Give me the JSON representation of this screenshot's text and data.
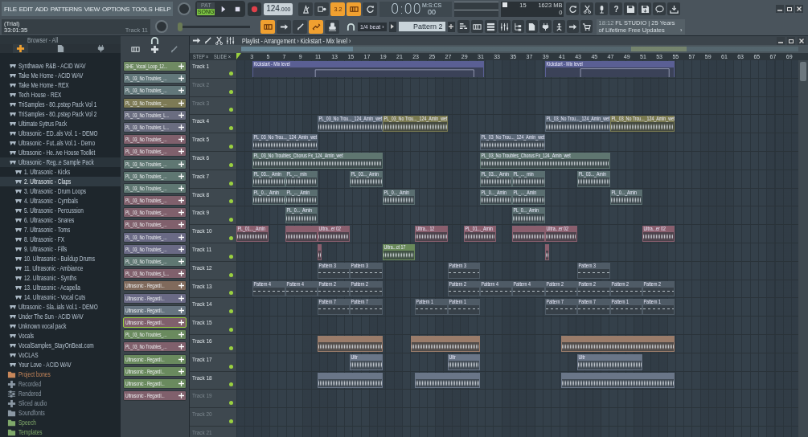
{
  "menu": [
    "FILE",
    "EDIT",
    "ADD",
    "PATTERNS",
    "VIEW",
    "OPTIONS",
    "TOOLS",
    "HELP"
  ],
  "hint": {
    "line_1": "(Trial)",
    "line_2": "33:01:35",
    "target": "Track 11"
  },
  "transport": {
    "modes": [
      {
        "label": "PAT",
        "selected": false
      },
      {
        "label": "SONG",
        "selected": true
      }
    ],
    "tempo": "124",
    "tempo_fraction": ".000"
  },
  "record_toggles": [
    {
      "kind": "metronome",
      "on": false
    },
    {
      "kind": "wait",
      "on": false
    },
    {
      "kind": "countdown",
      "label": "3.2",
      "on": true
    },
    {
      "kind": "keyboard",
      "on": true
    },
    {
      "kind": "loop",
      "on": false
    }
  ],
  "time": {
    "value": "0:00",
    "centis": "00",
    "units": "M:S:CS"
  },
  "cpu": {
    "cpu": "15",
    "memory": "1623 MB",
    "polyphony": "0"
  },
  "top_icons": [
    {
      "kind": "refresh"
    },
    {
      "kind": "cut"
    },
    {
      "kind": "mic"
    },
    {
      "kind": "help",
      "label": "?"
    },
    {
      "kind": "save"
    },
    {
      "kind": "export"
    },
    {
      "kind": "chat"
    },
    {
      "kind": "download"
    }
  ],
  "pitch": {
    "level": 0.0
  },
  "edit_toggles": [
    {
      "kind": "piano",
      "on": true
    },
    {
      "kind": "arrow",
      "on": false
    },
    {
      "kind": "brush",
      "on": false
    },
    {
      "kind": "link",
      "on": true
    },
    {
      "kind": "stamp",
      "on": false
    }
  ],
  "snap": "1/4 beat ›",
  "pattern": "Pattern 2",
  "view_icons": [
    {
      "kind": "playlist"
    },
    {
      "kind": "piano"
    },
    {
      "kind": "rack"
    },
    {
      "kind": "mixer"
    },
    {
      "kind": "tree"
    },
    {
      "kind": "page"
    },
    {
      "kind": "plug"
    },
    {
      "kind": "figure"
    },
    {
      "kind": "pointer"
    },
    {
      "kind": "cart"
    }
  ],
  "news": {
    "time": "18:12",
    "line_1": "FL STUDIO | 25 Years",
    "line_2": "of Lifetime Free Updates",
    "arrow": "›"
  },
  "browser": {
    "title": "Browser - All",
    "tabs": [
      {
        "kind": "all",
        "selected": true
      },
      {
        "kind": "page",
        "selected": false
      },
      {
        "kind": "plug",
        "selected": false
      }
    ],
    "packs": [
      {
        "label": "Synthwave R&B - ACID WAV",
        "selected": false,
        "expanded": false
      },
      {
        "label": "Take Me Home - ACID WAV",
        "selected": false,
        "expanded": false
      },
      {
        "label": "Take Me Home - REX",
        "selected": false,
        "expanded": false
      },
      {
        "label": "Tech House - REX",
        "selected": false,
        "expanded": false
      },
      {
        "label": "TriSamples - 80..pstep Pack Vol 1",
        "selected": false,
        "expanded": false
      },
      {
        "label": "TriSamples - 80..pstep Pack Vol 2",
        "selected": false,
        "expanded": false
      },
      {
        "label": "Ultimate Sytrus Pack",
        "selected": false,
        "expanded": false
      },
      {
        "label": "Ultrasonic - ED..als Vol. 1 - DEMO",
        "selected": false,
        "expanded": false
      },
      {
        "label": "Ultrasonic - Fut..als Vol.1 - Demo",
        "selected": false,
        "expanded": false
      },
      {
        "label": "Ultrasonic - He..ive House Toolkit",
        "selected": false,
        "expanded": false
      },
      {
        "label": "Ultrasonic - Reg..e Sample Pack",
        "selected": false,
        "expanded": true,
        "children": [
          {
            "label": "1. Ultrasonic - Kicks",
            "selected": false
          },
          {
            "label": "2. Ultrasonic - Claps",
            "selected": true
          },
          {
            "label": "3. Ultrasonic - Drum Loops",
            "selected": false
          },
          {
            "label": "4. Ultrasonic - Cymbals",
            "selected": false
          },
          {
            "label": "5. Ultrasonic - Percussion",
            "selected": false
          },
          {
            "label": "6. Ultrasonic - Snares",
            "selected": false
          },
          {
            "label": "7. Ultrasonic - Toms",
            "selected": false
          },
          {
            "label": "8. Ultrasonic - FX",
            "selected": false
          },
          {
            "label": "9. Ultrasonic - Fills",
            "selected": false
          },
          {
            "label": "10. Ultrasonic - Buildup Drums",
            "selected": false
          },
          {
            "label": "11. Ultrasonic - Ambiance",
            "selected": false
          },
          {
            "label": "12. Ultrasonic - Synths",
            "selected": false
          },
          {
            "label": "13. Ultrasonic - Acapella",
            "selected": false
          },
          {
            "label": "14. Ultrasonic - Vocal Cuts",
            "selected": false
          }
        ]
      },
      {
        "label": "Ultrasonic - Sla..ials Vol.1 - DEMO",
        "selected": false,
        "expanded": false
      },
      {
        "label": "Under The Sun - ACID WAV",
        "selected": false,
        "expanded": false
      },
      {
        "label": "Unknown vocal pack",
        "selected": false,
        "expanded": false
      },
      {
        "label": "Vocals",
        "selected": false,
        "expanded": false
      },
      {
        "label": "VocalSamples_StayOnBeat.com",
        "selected": false,
        "expanded": false
      },
      {
        "label": "VoCLAS",
        "selected": false,
        "expanded": false
      },
      {
        "label": "Your Love - ACID WAV",
        "selected": false,
        "expanded": false
      }
    ],
    "folders": [
      {
        "label": "Project bones",
        "kind": "folder",
        "color": "#c8875a"
      },
      {
        "label": "Recorded",
        "kind": "plus",
        "color": "#8a97a3"
      },
      {
        "label": "Rendered",
        "kind": "rendered",
        "color": "#8a97a3"
      },
      {
        "label": "Sliced audio",
        "kind": "plus",
        "color": "#8a97a3"
      },
      {
        "label": "Soundfonts",
        "kind": "folder",
        "color": "#8a97a3"
      },
      {
        "label": "Speech",
        "kind": "folder",
        "color": "#7fa86a"
      },
      {
        "label": "Templates",
        "kind": "folder",
        "color": "#7fa86a"
      }
    ]
  },
  "channels": [
    {
      "name": "SHE_Vocal_Loop_12...",
      "color": "#6f8a62",
      "selected": false
    },
    {
      "name": "PL_03_No Troubles_...",
      "color": "#62777a",
      "selected": false
    },
    {
      "name": "PL_03_No Troubles_...",
      "color": "#62777a",
      "selected": false
    },
    {
      "name": "PL_03_No Troubles_...",
      "color": "#7d7a55",
      "selected": false
    },
    {
      "name": "PL_03_No Troubles_L...",
      "color": "#6a6d80",
      "selected": false
    },
    {
      "name": "PL_03_No Troubles_L...",
      "color": "#6a6d80",
      "selected": false
    },
    {
      "name": "PL_03_No Troubles_...",
      "color": "#80606c",
      "selected": false
    },
    {
      "name": "PL_03_No Troubles_...",
      "color": "#80606c",
      "selected": false
    },
    {
      "name": "PL_03_No Troubles_...",
      "color": "#5f7772",
      "selected": false
    },
    {
      "name": "PL_03_No Troubles_...",
      "color": "#5f7772",
      "selected": false
    },
    {
      "name": "PL_03_No Troubles_...",
      "color": "#5f7772",
      "selected": false
    },
    {
      "name": "PL_03_No Troubles_...",
      "color": "#80606c",
      "selected": false
    },
    {
      "name": "PL_03_No Troubles_...",
      "color": "#80606c",
      "selected": false
    },
    {
      "name": "PL_03_No Troubles_...",
      "color": "#80606c",
      "selected": false
    },
    {
      "name": "PL_03_No Troubles_...",
      "color": "#6a6a85",
      "selected": false
    },
    {
      "name": "PL_03_No Troubles_...",
      "color": "#6a6a85",
      "selected": false
    },
    {
      "name": "PL_03_No Troubles_...",
      "color": "#5f7772",
      "selected": false
    },
    {
      "name": "PL_03_No Troubles_L...",
      "color": "#80606c",
      "selected": false
    },
    {
      "name": "Ultrasonic - Regardl...",
      "color": "#806a5c",
      "selected": false
    },
    {
      "name": "Ultrasonic - Regardl...",
      "color": "#6a6a85",
      "selected": false
    },
    {
      "name": "Ultrasonic - Regardl...",
      "color": "#667480",
      "selected": false
    },
    {
      "name": "Ultrasonic - Regardl...",
      "color": "#80606c",
      "selected": true
    },
    {
      "name": "PL_03_No Troubles_...",
      "color": "#6a8a5e",
      "selected": false
    },
    {
      "name": "PL_03_No Troubles_...",
      "color": "#80606c",
      "selected": false
    },
    {
      "name": "Ultrasonic - Regardl...",
      "color": "#6a8a5e",
      "selected": false
    },
    {
      "name": "Ultrasonic - Regardl...",
      "color": "#6a8a5e",
      "selected": false
    },
    {
      "name": "Ultrasonic - Regardl...",
      "color": "#6a8a5e",
      "selected": false
    },
    {
      "name": "Ultrasonic - Regardl...",
      "color": "#80606c",
      "selected": false
    }
  ],
  "playlist": {
    "title": "Playlist - Arrangement › Kickstart - Mix level ›",
    "header_labels": [
      "STEP ×",
      "SLIDE ×"
    ],
    "ruler": [
      "3",
      "5",
      "7",
      "9",
      "11",
      "13",
      "15",
      "17",
      "19",
      "21",
      "23",
      "25",
      "27",
      "29",
      "31",
      "33",
      "35",
      "37",
      "39",
      "41",
      "43",
      "45",
      "47",
      "49",
      "51",
      "53",
      "55",
      "57",
      "59",
      "61",
      "63",
      "65",
      "67",
      "69"
    ],
    "tracks": [
      {
        "label": "Track 1",
        "empty": false,
        "clips": [
          {
            "kind": "automation",
            "label": "Kickstart - Mix level",
            "color": "#5a5f94"
          },
          {
            "kind": "automation",
            "label": "Kickstart - Mix level",
            "color": "#5a5f94"
          }
        ]
      },
      {
        "label": "Track 2",
        "empty": true
      },
      {
        "label": "Track 3",
        "empty": true
      },
      {
        "label": "Track 4",
        "empty": false,
        "clips": [
          {
            "kind": "audio",
            "label": "PL_03_No Trou..._124_Amin_wet",
            "color": "#5b6877"
          },
          {
            "kind": "audio",
            "label": "PL_03_No Trou..._124_Amin_wet",
            "color": "#7a7a50"
          },
          {
            "kind": "audio",
            "label": "PL_03_No Trou..._124_Amin_wet",
            "color": "#5b6877"
          },
          {
            "kind": "audio",
            "label": "PL_03_No Trou..._124_Amin_wet",
            "color": "#7a7a50"
          }
        ]
      },
      {
        "label": "Track 5",
        "empty": false,
        "clips": [
          {
            "kind": "audio",
            "label": "PL_03_No Trou..._124_Amin_wet",
            "color": "#5b6877"
          },
          {
            "kind": "audio",
            "label": "PL_03_No Trou..._124_Amin_wet",
            "color": "#5b6877"
          }
        ]
      },
      {
        "label": "Track 6",
        "empty": false,
        "clips": [
          {
            "kind": "audio",
            "label": "PL_03_No Troubles_Chorus Fx_124_Amin_wet",
            "color": "#5f7670"
          },
          {
            "kind": "audio",
            "label": "PL_03_No Troubles_Chorus Fx_124_Amin_wet",
            "color": "#5f7670"
          }
        ]
      },
      {
        "label": "Track 7",
        "empty": false,
        "clips": [
          {
            "kind": "audio",
            "label": "PL_03..._Amin",
            "color": "#5a6e70"
          },
          {
            "kind": "audio",
            "label": "PL_..._min",
            "color": "#5a6e70"
          },
          {
            "kind": "audio",
            "label": "PL_03..._Amin",
            "color": "#5a6e70"
          },
          {
            "kind": "audio",
            "label": "PL_03..._Amin",
            "color": "#5a6e70"
          },
          {
            "kind": "audio",
            "label": "PL_..._min",
            "color": "#5a6e70"
          },
          {
            "kind": "audio",
            "label": "PL_03..._Amin",
            "color": "#5a6e70"
          }
        ]
      },
      {
        "label": "Track 8",
        "empty": false,
        "clips": [
          {
            "kind": "audio",
            "label": "PL_0..._Amin",
            "color": "#5a6e70"
          },
          {
            "kind": "audio",
            "label": "PL_..._Amin",
            "color": "#5a6e70"
          },
          {
            "kind": "audio",
            "label": "PL_0..._Amin",
            "color": "#5a6e70"
          },
          {
            "kind": "audio",
            "label": "PL_0..._Amin",
            "color": "#5a6e70"
          },
          {
            "kind": "audio",
            "label": "PL_..._Amin",
            "color": "#5a6e70"
          },
          {
            "kind": "audio",
            "label": "PL_0..._Amin",
            "color": "#5a6e70"
          }
        ]
      },
      {
        "label": "Track 9",
        "empty": false,
        "clips": [
          {
            "kind": "audio",
            "label": "PL_0..._Amin",
            "color": "#5a6e70"
          },
          {
            "kind": "audio",
            "label": "PL_0..._Amin",
            "color": "#5a6e70"
          }
        ]
      },
      {
        "label": "Track 10",
        "empty": false,
        "clips": [
          {
            "kind": "audio",
            "label": "PL_01..._Amin",
            "color": "#8a5f6e"
          },
          {
            "kind": "audio",
            "color": "#8a5f6e"
          },
          {
            "kind": "audio",
            "label": "Ultra...er 02",
            "color": "#8a5f6e"
          },
          {
            "kind": "audio",
            "label": "Ultra... 12",
            "color": "#8a5f6e"
          },
          {
            "kind": "audio",
            "label": "PL_01..._Amin",
            "color": "#8a5f6e"
          },
          {
            "kind": "audio",
            "color": "#8a5f6e"
          },
          {
            "kind": "audio",
            "label": "Ultra...er 02",
            "color": "#8a5f6e"
          },
          {
            "kind": "audio",
            "label": "Ultra...er 02",
            "color": "#8a5f6e"
          }
        ]
      },
      {
        "label": "Track 11",
        "empty": false,
        "clips": [
          {
            "kind": "audio",
            "color": "#8a5f6e"
          },
          {
            "kind": "audio",
            "label": "Ultra...ct 17",
            "color": "#6a8a5a"
          },
          {
            "kind": "audio",
            "color": "#8a5f6e"
          }
        ]
      },
      {
        "label": "Track 12",
        "empty": false,
        "clips": [
          {
            "kind": "pattern",
            "label": "Pattern 3",
            "color": "#4f5b66"
          },
          {
            "kind": "pattern",
            "label": "Pattern 3",
            "color": "#4f5b66"
          },
          {
            "kind": "pattern",
            "label": "Pattern 3",
            "color": "#4f5b66"
          },
          {
            "kind": "pattern",
            "label": "Pattern 3",
            "color": "#4f5b66"
          }
        ]
      },
      {
        "label": "Track 13",
        "empty": false,
        "clips": [
          {
            "kind": "pattern",
            "label": "Pattern 4",
            "color": "#4f5b66"
          },
          {
            "kind": "pattern",
            "label": "Pattern 4",
            "color": "#4f5b66"
          },
          {
            "kind": "pattern",
            "label": "Pattern 2",
            "color": "#4f5b66"
          },
          {
            "kind": "pattern",
            "label": "Pattern 2",
            "color": "#4f5b66"
          },
          {
            "kind": "pattern",
            "label": "Pattern 2",
            "color": "#4f5b66"
          },
          {
            "kind": "pattern",
            "label": "Pattern 4",
            "color": "#4f5b66"
          },
          {
            "kind": "pattern",
            "label": "Pattern 4",
            "color": "#4f5b66"
          },
          {
            "kind": "pattern",
            "label": "Pattern 2",
            "color": "#4f5b66"
          },
          {
            "kind": "pattern",
            "label": "Pattern 2",
            "color": "#4f5b66"
          },
          {
            "kind": "pattern",
            "label": "Pattern 2",
            "color": "#4f5b66"
          },
          {
            "kind": "pattern",
            "label": "Pattern 2",
            "color": "#4f5b66"
          }
        ]
      },
      {
        "label": "Track 14",
        "empty": false,
        "clips": [
          {
            "kind": "pattern",
            "label": "Pattern 7",
            "color": "#4f5b66"
          },
          {
            "kind": "pattern",
            "label": "Pattern 7",
            "color": "#4f5b66"
          },
          {
            "kind": "pattern",
            "label": "Pattern 1",
            "color": "#4f5b66"
          },
          {
            "kind": "pattern",
            "label": "Pattern 1",
            "color": "#4f5b66"
          },
          {
            "kind": "pattern",
            "label": "Pattern 7",
            "color": "#4f5b66"
          },
          {
            "kind": "pattern",
            "label": "Pattern 7",
            "color": "#4f5b66"
          },
          {
            "kind": "pattern",
            "label": "Pattern 1",
            "color": "#4f5b66"
          },
          {
            "kind": "pattern",
            "label": "Pattern 1",
            "color": "#4f5b66"
          }
        ]
      },
      {
        "label": "Track 15",
        "empty": false
      },
      {
        "label": "Track 16",
        "empty": false,
        "clips": [
          {
            "kind": "audio",
            "color": "#9a7c6a"
          },
          {
            "kind": "audio",
            "color": "#9a7c6a"
          },
          {
            "kind": "audio",
            "color": "#9a7c6a"
          }
        ]
      },
      {
        "label": "Track 17",
        "empty": false,
        "clips": [
          {
            "kind": "audio",
            "label": "Ultr",
            "color": "#6a7688"
          },
          {
            "kind": "audio",
            "label": "Ultr",
            "color": "#6a7688"
          },
          {
            "kind": "audio",
            "label": "Ultr",
            "color": "#6a7688"
          }
        ]
      },
      {
        "label": "Track 18",
        "empty": false,
        "clips": [
          {
            "kind": "audio",
            "color": "#6a7688"
          },
          {
            "kind": "audio",
            "color": "#6a7688"
          },
          {
            "kind": "audio",
            "color": "#6a7688"
          }
        ]
      },
      {
        "label": "Track 19",
        "empty": true
      },
      {
        "label": "Track 20",
        "empty": true
      },
      {
        "label": "Track 21",
        "empty": true
      }
    ]
  }
}
